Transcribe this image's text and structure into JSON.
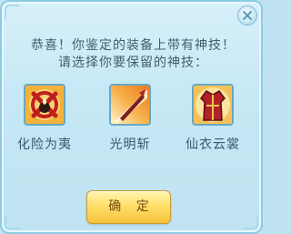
{
  "dialog": {
    "message_line1": "恭喜！你鉴定的装备上带有神技！",
    "message_line2": "请选择你要保留的神技：",
    "skills": [
      {
        "name": "化险为夷",
        "icon": "crossed-circle-icon"
      },
      {
        "name": "光明斩",
        "icon": "glowing-blade-icon"
      },
      {
        "name": "仙衣云裳",
        "icon": "red-robe-icon"
      }
    ],
    "confirm_label": "确 定",
    "close_icon": "close-icon"
  }
}
